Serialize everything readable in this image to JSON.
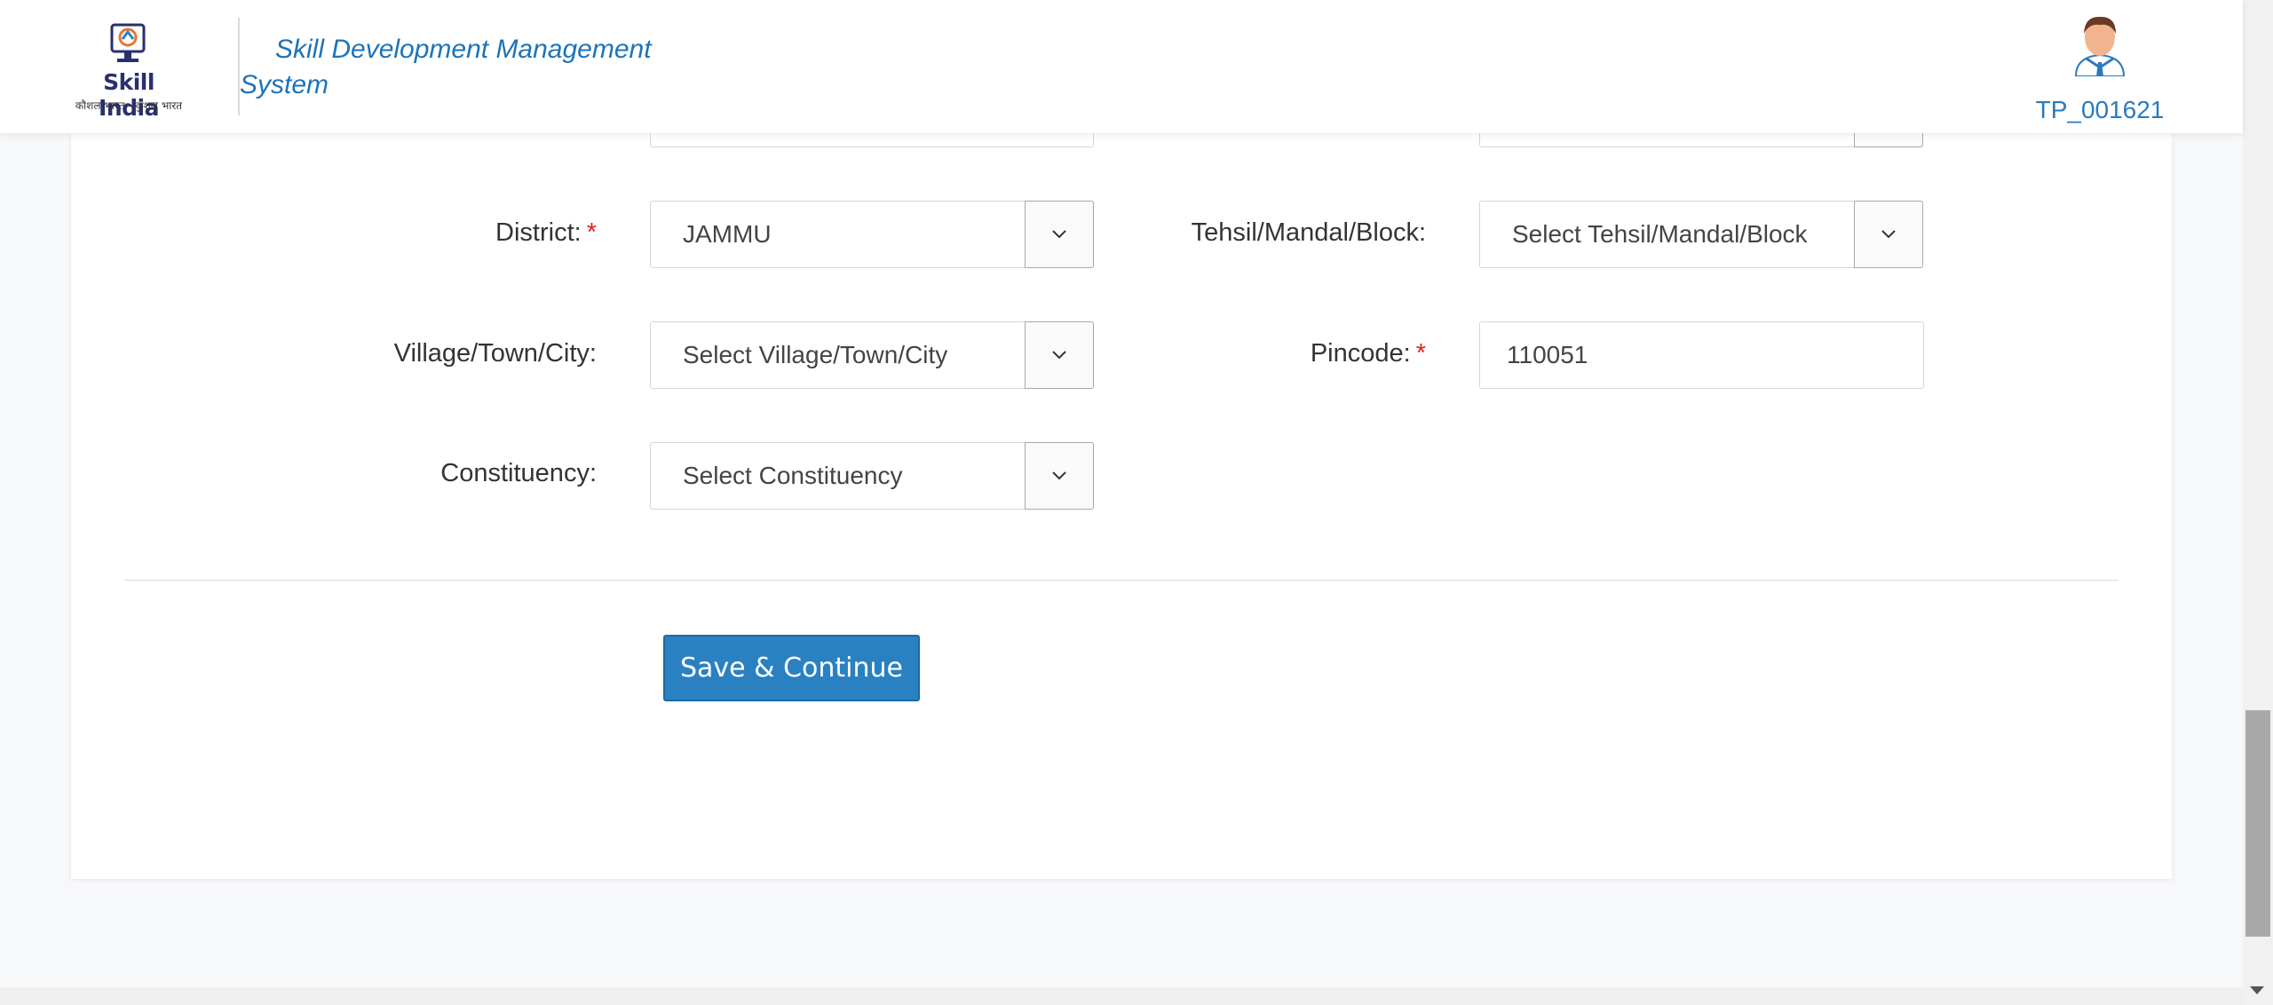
{
  "header": {
    "logo_text": "Skill India",
    "logo_sub": "कौशल भारत - कुशल भारत",
    "system_title": "Skill Development Management System",
    "user_id": "TP_001621"
  },
  "form": {
    "district": {
      "label": "District:",
      "required_mark": "*",
      "value": "JAMMU"
    },
    "tehsil": {
      "label": "Tehsil/Mandal/Block:",
      "value": "Select Tehsil/Mandal/Block"
    },
    "village": {
      "label": "Village/Town/City:",
      "value": "Select Village/Town/City"
    },
    "pincode": {
      "label": "Pincode:",
      "required_mark": "*",
      "value": "110051"
    },
    "constituency": {
      "label": "Constituency:",
      "value": "Select Constituency"
    }
  },
  "actions": {
    "save_label": "Save & Continue"
  },
  "colors": {
    "brand_blue": "#1d73b8",
    "button": "#2a81c2",
    "required": "#e02424"
  },
  "icons": [
    "skill-india-logo-icon",
    "user-avatar-icon",
    "chevron-down-icon"
  ]
}
